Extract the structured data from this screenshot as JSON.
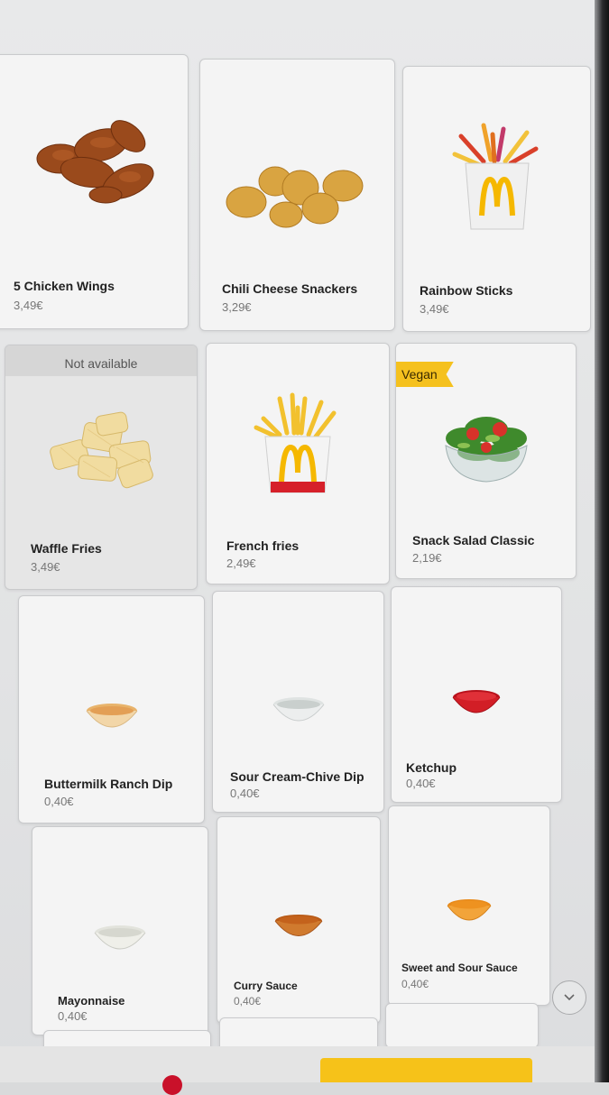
{
  "products": [
    {
      "name": "5 Chicken Wings",
      "price": "3,49€",
      "image": "chicken-wings"
    },
    {
      "name": "Chili Cheese Snackers",
      "price": "3,29€",
      "image": "cheese-snackers"
    },
    {
      "name": "Rainbow Sticks",
      "price": "3,49€",
      "image": "rainbow-sticks"
    },
    {
      "name": "Waffle Fries",
      "price": "3,49€",
      "image": "waffle-fries",
      "status": "Not available"
    },
    {
      "name": "French fries",
      "price": "2,49€",
      "image": "french-fries"
    },
    {
      "name": "Snack Salad Classic",
      "price": "2,19€",
      "image": "salad",
      "badge": "Vegan"
    },
    {
      "name": "Buttermilk Ranch Dip",
      "price": "0,40€",
      "image": "ranch-dip"
    },
    {
      "name": "Sour Cream-Chive Dip",
      "price": "0,40€",
      "image": "sour-cream-dip"
    },
    {
      "name": "Ketchup",
      "price": "0,40€",
      "image": "ketchup"
    },
    {
      "name": "Mayonnaise",
      "price": "0,40€",
      "image": "mayonnaise"
    },
    {
      "name": "Curry Sauce",
      "price": "0,40€",
      "image": "curry-sauce"
    },
    {
      "name": "Sweet and Sour Sauce",
      "price": "0,40€",
      "image": "sweet-sour-sauce"
    }
  ],
  "colors": {
    "accent": "#f6c219",
    "badge": "#f5c11e",
    "brand_red": "#d6202a",
    "brand_yellow": "#f5b800"
  },
  "scroll_icon": "chevron-down-icon"
}
